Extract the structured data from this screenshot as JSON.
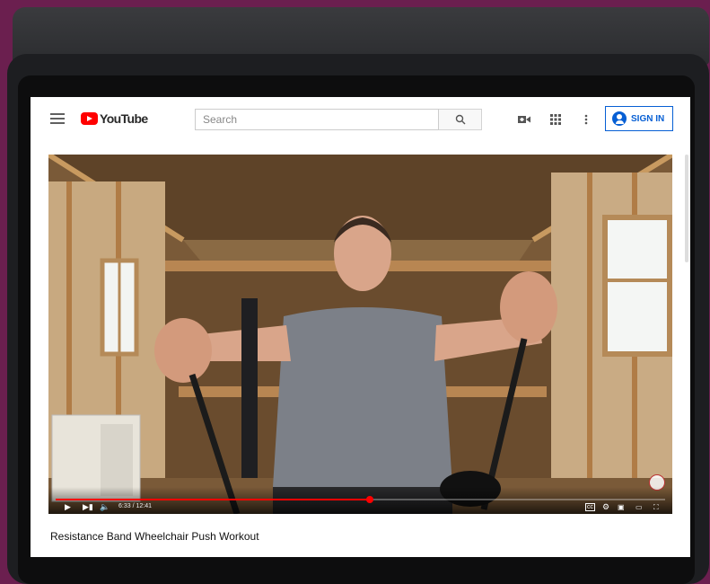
{
  "masthead": {
    "logo_text": "YouTube",
    "search_placeholder": "Search",
    "sign_in_label": "SIGN IN",
    "icons": [
      "menu-icon",
      "search-icon",
      "create-video-icon",
      "apps-grid-icon",
      "more-vert-icon",
      "account-icon"
    ]
  },
  "player": {
    "time_display": "6:33 / 12:41",
    "progress": 0.516,
    "icons": [
      "play-icon",
      "next-icon",
      "volume-icon",
      "captions-icon",
      "settings-icon",
      "miniplayer-icon",
      "theater-icon",
      "fullscreen-icon"
    ]
  },
  "video": {
    "title": "Resistance Band Wheelchair Push Workout"
  },
  "colors": {
    "brand_red": "#ff0000",
    "sign_in_blue": "#065fd4",
    "background": "#6b1f4f"
  }
}
